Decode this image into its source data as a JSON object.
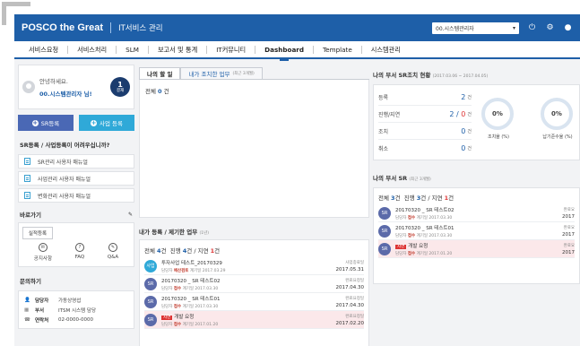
{
  "header": {
    "brand": "POSCO the Great",
    "system_name": "IT서비스 관리",
    "user_select": "00.시스템관리자",
    "icons": [
      "power-icon",
      "gear-icon",
      "user-icon"
    ]
  },
  "menu": [
    "서비스요청",
    "서비스처리",
    "SLM",
    "보고서 및 통계",
    "IT커뮤니티",
    "Dashboard",
    "Template",
    "시스템관리"
  ],
  "menu_active": "Dashboard",
  "welcome": {
    "greeting": "안녕하세요.",
    "user": "00.시스템관리자 님!",
    "badge_count": "1",
    "badge_label": "결재"
  },
  "buttons": {
    "sr_register": "SR등록",
    "biz_register": "사업 등록"
  },
  "manuals": {
    "title": "SR등록 / 사업등록이 어려우십니까?",
    "items": [
      "SR관리 사용자 매뉴얼",
      "사업관리 사용자 매뉴얼",
      "변화관리 사용자 매뉴얼"
    ]
  },
  "shortcuts": {
    "title": "바로가기",
    "report_label": "실적등록",
    "items": [
      {
        "label": "공지사항",
        "icon": "megaphone-icon"
      },
      {
        "label": "FAQ",
        "icon": "question-icon"
      },
      {
        "label": "Q&A",
        "icon": "chat-icon"
      }
    ]
  },
  "contact": {
    "title": "문의하기",
    "rows": [
      {
        "key": "담당자",
        "value": "가동상영섭",
        "icon": "person-icon"
      },
      {
        "key": "부서",
        "value": "ITSM 시스템 담당",
        "icon": "building-icon"
      },
      {
        "key": "연락처",
        "value": "02-0000-0000",
        "icon": "phone-icon"
      }
    ]
  },
  "tabs": {
    "my_task": "나의 할 일",
    "my_done": "내가 조치한 업무",
    "my_done_note": "(최근 3개월)"
  },
  "my_task": {
    "total_label": "전체",
    "total_value": "0",
    "unit": "건"
  },
  "registered": {
    "title": "내가 등록 / 제기한 업무",
    "note": "(1년)",
    "summary": {
      "total_label": "전체",
      "total": "4",
      "progress_label": "진행",
      "progress": "4",
      "delay_label": "지연",
      "delay": "1",
      "unit": "건"
    },
    "items": [
      {
        "type": "사업",
        "title": "투자사업 테스트_20170329",
        "owner": "담당자",
        "stage": "예산검토",
        "sub": "계기일 2017.03.29",
        "status": "사업종료일",
        "date": "2017.05.31",
        "tag": ""
      },
      {
        "type": "SR",
        "title": "20170320 _ SR 테스트02",
        "owner": "담당자",
        "stage": "접수",
        "sub": "계기일 2017.03.30",
        "status": "완료요청일",
        "date": "2017.04.30",
        "tag": ""
      },
      {
        "type": "SR",
        "title": "20170320 _ SR 테스트01",
        "owner": "담당자",
        "stage": "접수",
        "sub": "계기일 2017.03.30",
        "status": "완료요청일",
        "date": "2017.04.30",
        "tag": ""
      },
      {
        "type": "SR",
        "title": "개발 요청",
        "owner": "담당자",
        "stage": "접수",
        "sub": "계기일 2017.01.20",
        "status": "완료요청일",
        "date": "2017.02.20",
        "tag": "지연"
      }
    ]
  },
  "dept_status": {
    "title": "나의 부서 SR조치 현황",
    "period": "(2017.03.06 ~ 2017.04.05)",
    "rows": [
      {
        "label": "등록",
        "value": "2",
        "red": ""
      },
      {
        "label": "진행/지연",
        "value": "2",
        "red": "0"
      },
      {
        "label": "조치",
        "value": "0",
        "red": ""
      },
      {
        "label": "취소",
        "value": "0",
        "red": ""
      }
    ],
    "unit": "건",
    "gauges": [
      {
        "value": "0%",
        "label": "조치율 (%)"
      },
      {
        "value": "0%",
        "label": "납기준수율 (%)"
      }
    ]
  },
  "dept_sr": {
    "title": "나의 부서 SR",
    "note": "(최근 3개월)",
    "summary": {
      "total_label": "전체",
      "total": "3",
      "progress_label": "진행",
      "progress": "3",
      "delay_label": "지연",
      "delay": "1",
      "unit": "건"
    },
    "items": [
      {
        "type": "SR",
        "title": "20170320 _ SR 테스트02",
        "owner": "담당자",
        "stage": "접수",
        "sub": "계기일 2017.03.30",
        "status": "완료요",
        "date": "2017",
        "tag": ""
      },
      {
        "type": "SR",
        "title": "20170320 _ SR 테스트01",
        "owner": "담당자",
        "stage": "접수",
        "sub": "계기일 2017.03.30",
        "status": "완료요",
        "date": "2017",
        "tag": ""
      },
      {
        "type": "SR",
        "title": "개발 요청",
        "owner": "담당자",
        "stage": "접수",
        "sub": "계기일 2017.01.20",
        "status": "완료요",
        "date": "2017",
        "tag": "지연"
      }
    ]
  }
}
